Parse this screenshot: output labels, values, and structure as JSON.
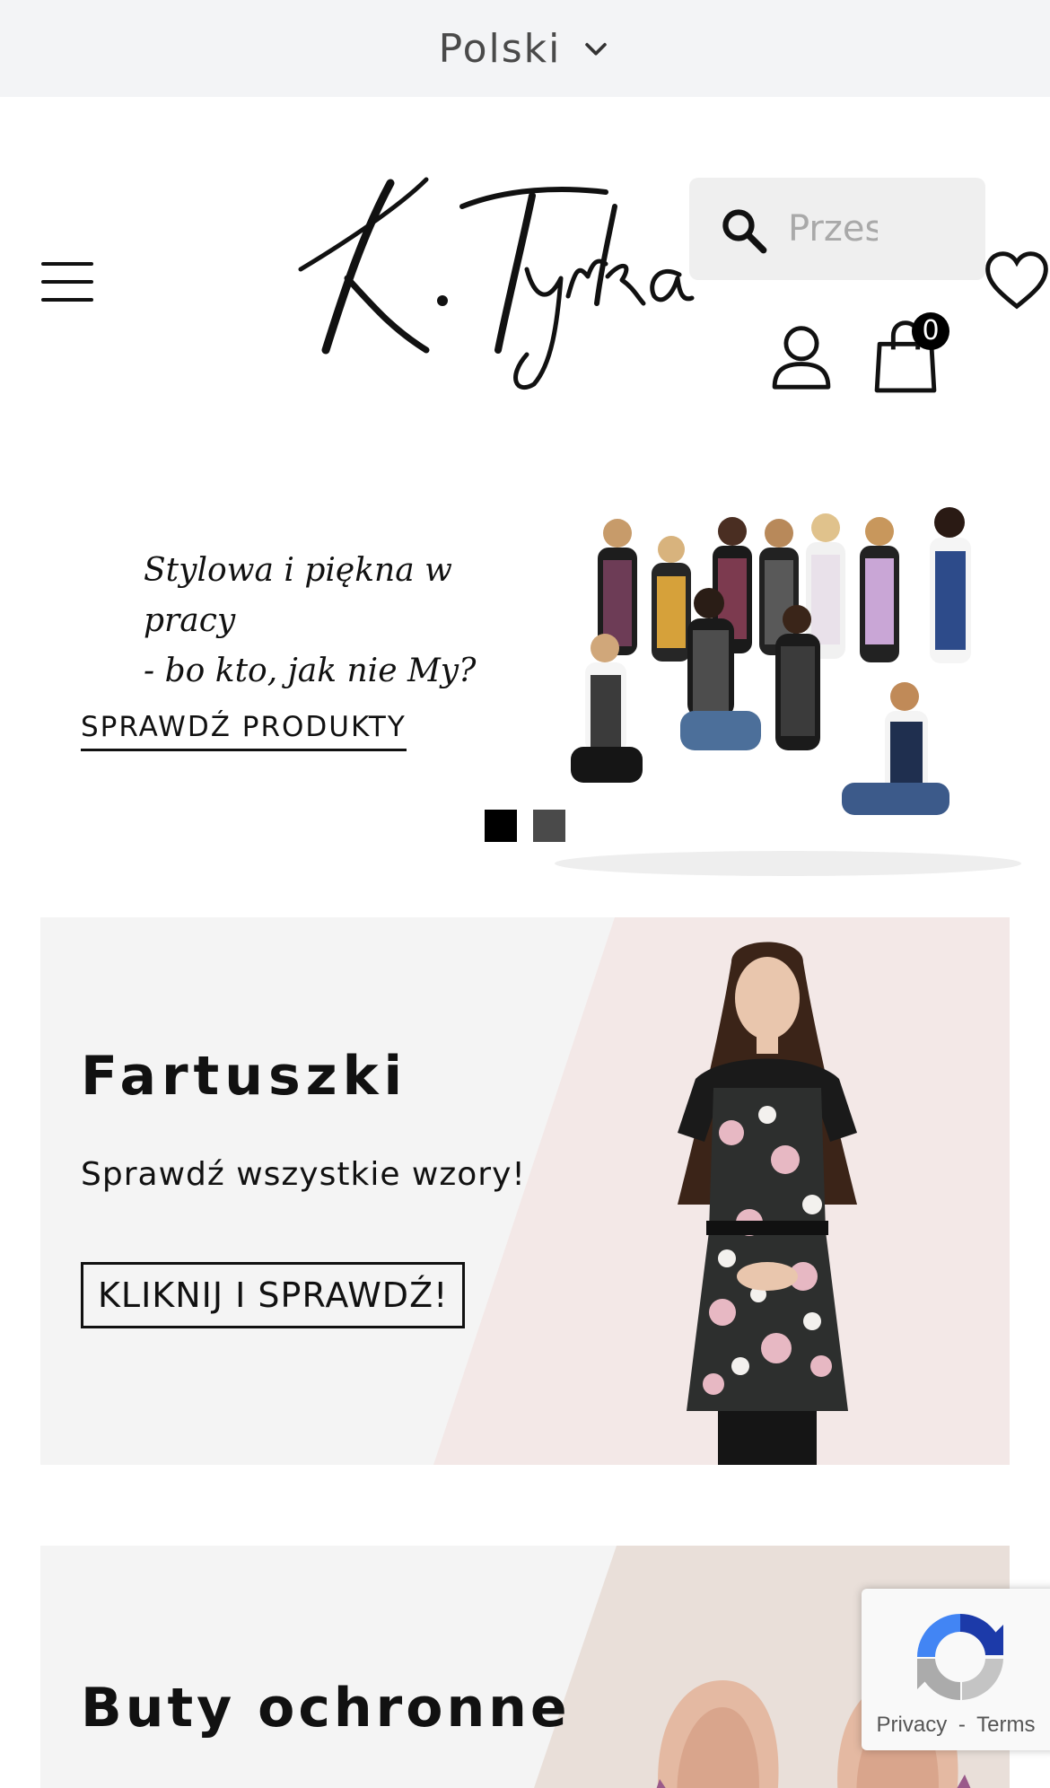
{
  "language": {
    "label": "Polski"
  },
  "header": {
    "logo_text": "K.Tyrka",
    "search_placeholder": "Przes",
    "cart_count": "0"
  },
  "hero": {
    "tagline_line1": "Stylowa i piękna w pracy",
    "tagline_line2": "- bo kto, jak nie My?",
    "cta_label": "SPRAWDŹ PRODUKTY",
    "slides": [
      {
        "active": true
      },
      {
        "active": false
      }
    ]
  },
  "categories": [
    {
      "title": "Fartuszki",
      "subtitle": "Sprawdź wszystkie wzory!",
      "button_label": "KLIKNIJ I SPRAWDŹ!",
      "accent_color": "#f3e8e7"
    },
    {
      "title": "Buty ochronne",
      "accent_color": "#e9dfd9"
    }
  ],
  "recaptcha": {
    "privacy_label": "Privacy",
    "separator": "-",
    "terms_label": "Terms"
  },
  "colors": {
    "topbar_bg": "#f3f4f6",
    "card_bg": "#f4f4f4",
    "text": "#111111"
  }
}
